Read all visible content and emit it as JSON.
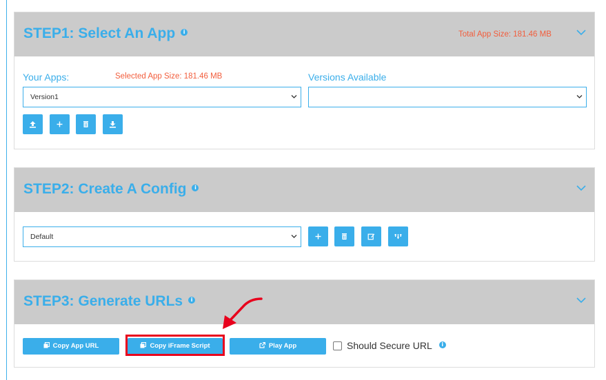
{
  "colors": {
    "accent": "#3aaeea",
    "header_bg": "#cbcbcb",
    "size_text": "#f25d3c",
    "annotation": "#e8001c"
  },
  "step1": {
    "title": "STEP1: Select An App",
    "total_size": "Total App Size: 181.46 MB",
    "your_apps_label": "Your Apps:",
    "selected_size": "Selected App Size: 181.46 MB",
    "versions_label": "Versions Available",
    "app_select_value": "Version1",
    "version_select_value": "",
    "buttons": [
      {
        "name": "upload-button",
        "icon": "upload-icon"
      },
      {
        "name": "add-app-button",
        "icon": "plus-icon"
      },
      {
        "name": "delete-app-button",
        "icon": "trash-icon"
      },
      {
        "name": "download-button",
        "icon": "download-icon"
      }
    ]
  },
  "step2": {
    "title": "STEP2: Create A Config",
    "config_select_value": "Default",
    "buttons": [
      {
        "name": "add-config-button",
        "icon": "plus-icon"
      },
      {
        "name": "delete-config-button",
        "icon": "trash-icon"
      },
      {
        "name": "edit-config-button",
        "icon": "edit-icon"
      },
      {
        "name": "config-settings-button",
        "icon": "settings-icon"
      }
    ]
  },
  "step3": {
    "title": "STEP3: Generate URLs",
    "copy_app_url": "Copy App URL",
    "copy_iframe": "Copy iFrame Script",
    "play_app": "Play App",
    "secure_label": "Should Secure URL",
    "secure_checked": false
  }
}
